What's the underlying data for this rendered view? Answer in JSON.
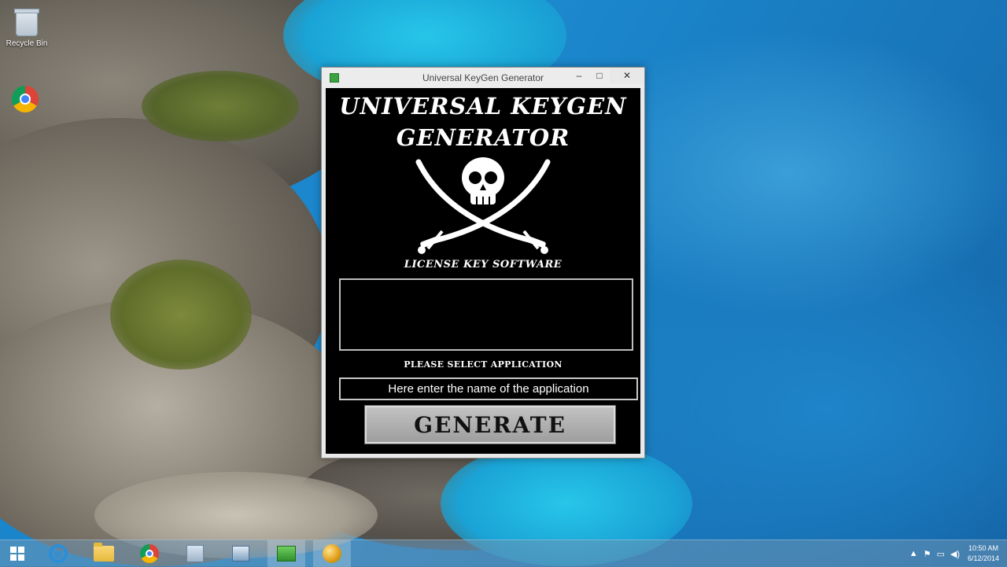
{
  "desktop": {
    "recycle_bin_label": "Recycle Bin",
    "icons": [
      "recycle-bin-icon",
      "chrome-icon"
    ]
  },
  "window": {
    "title": "Universal KeyGen Generator",
    "controls": {
      "minimize": "–",
      "maximize": "□",
      "close": "✕"
    }
  },
  "app": {
    "heading_line1": "Universal Keygen",
    "heading_line2": "Generator",
    "logo": "skull-crossed-swords-icon",
    "subtitle": "LICENSE KEY SOFTWARE",
    "output_value": "",
    "select_label": "PLEASE SELECT APPLICATION",
    "app_name_value": "Here enter the name of the application",
    "generate_label": "GENERATE"
  },
  "taskbar": {
    "items": [
      "start",
      "internet-explorer",
      "file-explorer",
      "chrome",
      "control-panel",
      "network",
      "keygen-app",
      "orb-app"
    ],
    "clock": {
      "time": "10:50 AM",
      "date": "6/12/2014"
    }
  },
  "colors": {
    "app_background": "#000000",
    "app_text": "#ffffff",
    "button_face": "#b0b0b0"
  }
}
